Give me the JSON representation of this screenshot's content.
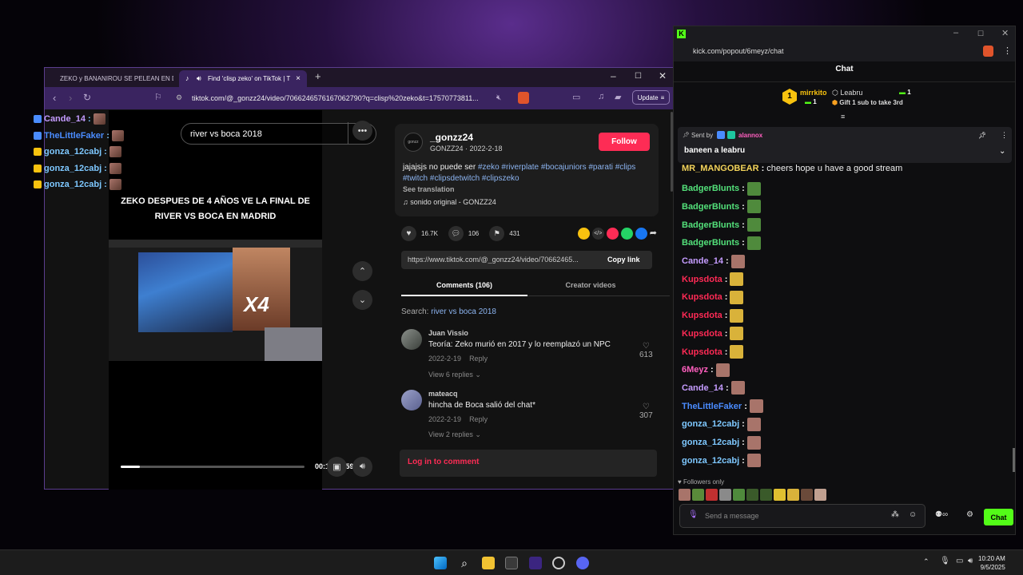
{
  "browser": {
    "tabs": [
      {
        "label": "ZEKO y BANANIROU SE PELEAN EN D"
      },
      {
        "label": "Find 'clisp zeko' on TikTok | T"
      }
    ],
    "url": "tiktok.com/@_gonzz24/video/7066246576167062790?q=clisp%20zeko&t=17570773811...",
    "update_label": "Update"
  },
  "video": {
    "search_text": "river vs boca 2018",
    "caption": "ZEKO DESPUES DE 4 AÑOS VE LA FINAL DE RIVER VS BOCA EN MADRID",
    "thumb_overlay": "X4",
    "time": "00:19/02:59",
    "progress": 0.106
  },
  "tiktok": {
    "author": "_gonzz24",
    "author_sub": "GONZZ24 · 2022-2-18",
    "avatar_text": "gonzz",
    "follow_label": "Follow",
    "desc_text": "jajajsjs no puede ser ",
    "hashtags": "#zeko #riverplate #bocajuniors #parati #clips #twitch #clipsdetwitch #clipszeko",
    "see_translation": "See translation",
    "sound": "sonido original - GONZZ24",
    "likes": "16.7K",
    "comments_count": "106",
    "saves": "431",
    "share_url": "https://www.tiktok.com/@_gonzz24/video/70662465...",
    "copy_link": "Copy link",
    "tab_comments": "Comments (106)",
    "tab_creator": "Creator videos",
    "search_prefix": "Search: ",
    "search_link": "river vs boca 2018",
    "comments": [
      {
        "user": "Juan Vissio",
        "text": "Teoría: Zeko murió en 2017 y lo reemplazó un NPC",
        "date": "2022-2-19",
        "reply": "Reply",
        "likes": "613",
        "view": "View 6 replies"
      },
      {
        "user": "mateacq",
        "text": "hincha de Boca salió del chat*",
        "date": "2022-2-19",
        "reply": "Reply",
        "likes": "307",
        "view": "View 2 replies"
      }
    ],
    "login": "Log in to comment"
  },
  "overlay_chat": [
    {
      "name": "Cande_14",
      "color": "#c59cff"
    },
    {
      "name": "TheLittleFaker",
      "color": "#4a8cff"
    },
    {
      "name": "gonza_12cabj",
      "color": "#7ec8ff"
    },
    {
      "name": "gonza_12cabj",
      "color": "#7ec8ff"
    },
    {
      "name": "gonza_12cabj",
      "color": "#7ec8ff"
    }
  ],
  "kick": {
    "url": "kick.com/popout/6meyz/chat",
    "chat_title": "Chat",
    "leader1_name": "mirrkito",
    "leader1_count": "1",
    "leader2_name": "Leabru",
    "leader2_count": "1",
    "gift_text": "Gift 1 sub to take 3rd",
    "pinned_sent_by": "Sent by",
    "pinned_user": "alannox",
    "pinned_text": "baneen a leabru",
    "messages": [
      {
        "user": "MR_MANGOBEAR",
        "color": "#f3d35a",
        "text": "cheers hope u have a good stream"
      },
      {
        "user": "BadgerBlunts",
        "color": "#53e07a",
        "text": ""
      },
      {
        "user": "BadgerBlunts",
        "color": "#53e07a",
        "text": ""
      },
      {
        "user": "BadgerBlunts",
        "color": "#53e07a",
        "text": ""
      },
      {
        "user": "BadgerBlunts",
        "color": "#53e07a",
        "text": ""
      },
      {
        "user": "Cande_14",
        "color": "#c59cff",
        "text": ""
      },
      {
        "user": "Kupsdota",
        "color": "#ff2a55",
        "text": ""
      },
      {
        "user": "Kupsdota",
        "color": "#ff2a55",
        "text": ""
      },
      {
        "user": "Kupsdota",
        "color": "#ff2a55",
        "text": ""
      },
      {
        "user": "Kupsdota",
        "color": "#ff2a55",
        "text": ""
      },
      {
        "user": "Kupsdota",
        "color": "#ff2a55",
        "text": ""
      },
      {
        "user": "6Meyz",
        "color": "#ff5fbf",
        "text": ""
      },
      {
        "user": "Cande_14",
        "color": "#c59cff",
        "text": ""
      },
      {
        "user": "TheLittleFaker",
        "color": "#4a8cff",
        "text": ""
      },
      {
        "user": "gonza_12cabj",
        "color": "#7ec8ff",
        "text": ""
      },
      {
        "user": "gonza_12cabj",
        "color": "#7ec8ff",
        "text": ""
      },
      {
        "user": "gonza_12cabj",
        "color": "#7ec8ff",
        "text": ""
      }
    ],
    "followers_only": "Followers only",
    "input_placeholder": "Send a message",
    "send_label": "Chat"
  },
  "taskbar": {
    "time": "10:20 AM",
    "date": "9/5/2025"
  }
}
